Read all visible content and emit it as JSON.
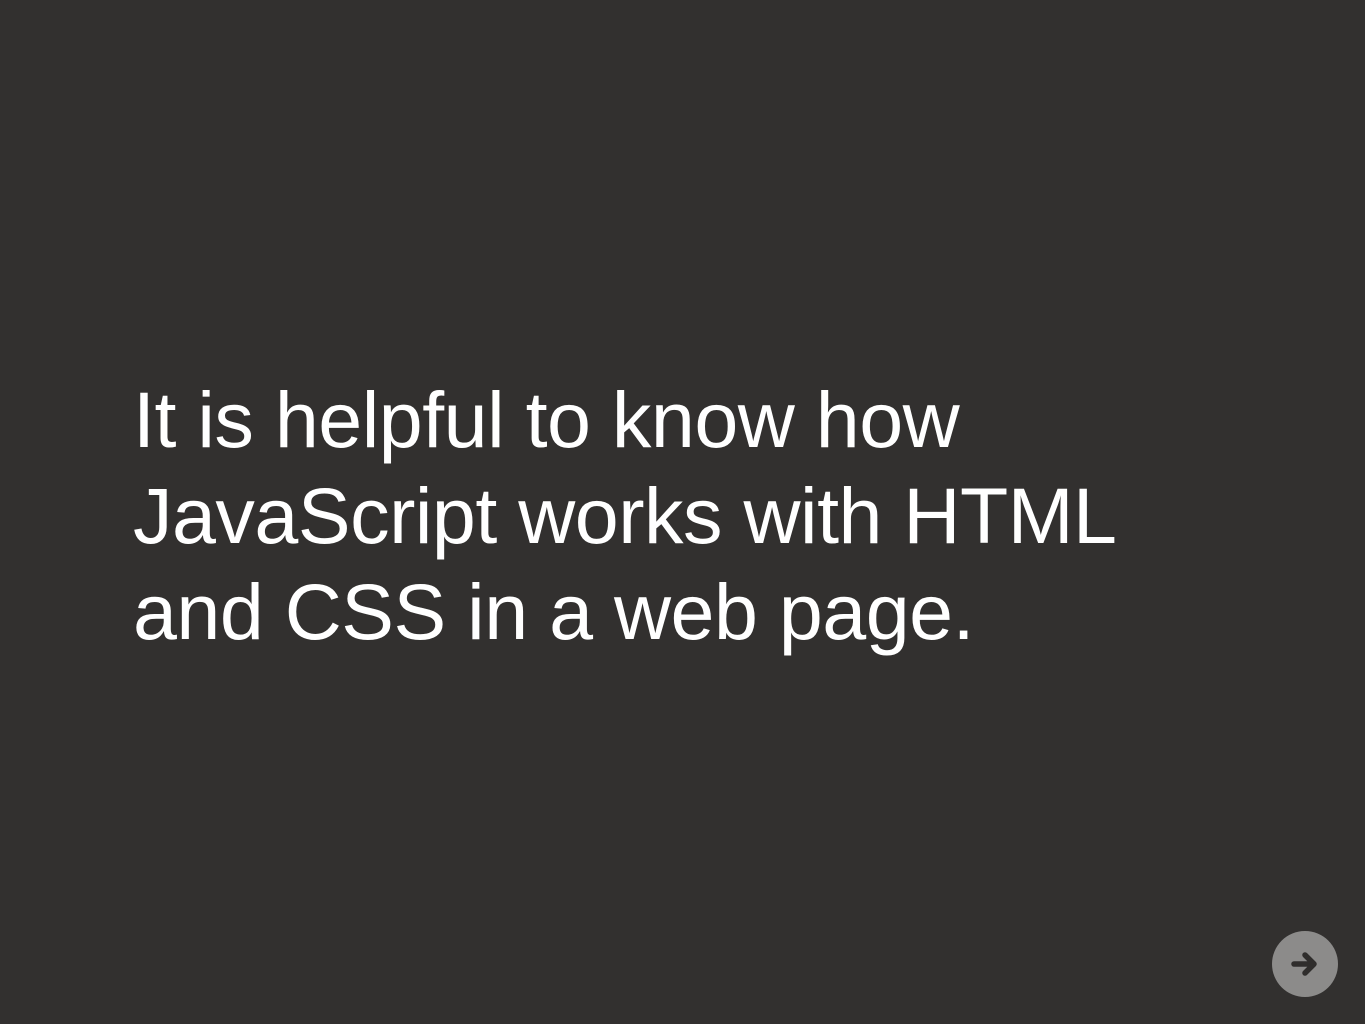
{
  "slide": {
    "lines": [
      "It is helpful to know how",
      "JavaScript works with HTML",
      "and CSS in a web page."
    ]
  },
  "navigation": {
    "next_icon": "arrow-right-icon"
  },
  "colors": {
    "background": "#32302f",
    "text": "#ffffff",
    "nav_button": "#8c8b8a",
    "nav_arrow": "#2f2d2c"
  }
}
